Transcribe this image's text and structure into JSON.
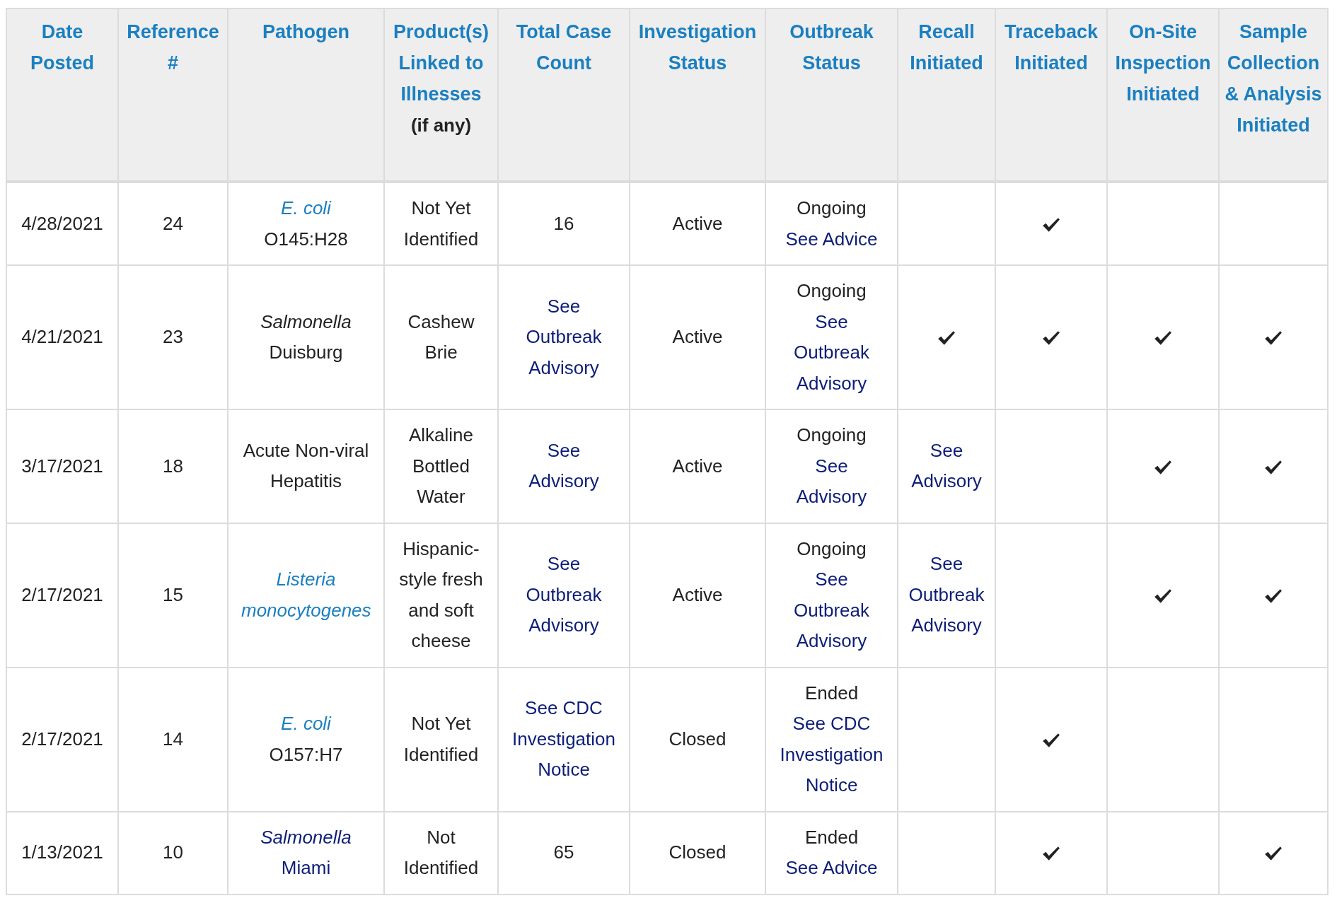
{
  "table": {
    "columns": [
      {
        "label": "Date Posted"
      },
      {
        "label": "Reference #"
      },
      {
        "label": "Pathogen"
      },
      {
        "label": "Product(s) Linked to Illnesses",
        "note": "(if any)"
      },
      {
        "label": "Total Case Count"
      },
      {
        "label": "Investigation Status"
      },
      {
        "label": "Outbreak Status"
      },
      {
        "label": "Recall Initiated"
      },
      {
        "label": "Traceback Initiated"
      },
      {
        "label": "On-Site Inspection Initiated"
      },
      {
        "label": "Sample Collection & Analysis Initiated"
      }
    ],
    "rows": [
      {
        "cells": [
          {
            "kind": "text",
            "parts": [
              {
                "text": "4/28/2021",
                "kind": "plain"
              }
            ]
          },
          {
            "kind": "text",
            "parts": [
              {
                "text": "24",
                "kind": "plain"
              }
            ]
          },
          {
            "kind": "text",
            "parts": [
              {
                "text": "E. coli",
                "kind": "species"
              },
              {
                "text": "O145:H28",
                "kind": "plain"
              }
            ]
          },
          {
            "kind": "text",
            "parts": [
              {
                "text": "Not Yet Identified",
                "kind": "plain"
              }
            ]
          },
          {
            "kind": "text",
            "parts": [
              {
                "text": "16",
                "kind": "plain"
              }
            ]
          },
          {
            "kind": "text",
            "parts": [
              {
                "text": "Active",
                "kind": "plain"
              }
            ]
          },
          {
            "kind": "text",
            "parts": [
              {
                "text": "Ongoing",
                "kind": "plain"
              },
              {
                "text": "See Advice",
                "kind": "link"
              }
            ]
          },
          {
            "kind": "check",
            "checked": false
          },
          {
            "kind": "check",
            "checked": true
          },
          {
            "kind": "check",
            "checked": false
          },
          {
            "kind": "check",
            "checked": false
          }
        ]
      },
      {
        "cells": [
          {
            "kind": "text",
            "parts": [
              {
                "text": "4/21/2021",
                "kind": "plain"
              }
            ]
          },
          {
            "kind": "text",
            "parts": [
              {
                "text": "23",
                "kind": "plain"
              }
            ]
          },
          {
            "kind": "text",
            "parts": [
              {
                "text": "Salmonella",
                "kind": "italic"
              },
              {
                "text": "Duisburg",
                "kind": "plain"
              }
            ]
          },
          {
            "kind": "text",
            "parts": [
              {
                "text": "Cashew Brie",
                "kind": "plain"
              }
            ]
          },
          {
            "kind": "text",
            "parts": [
              {
                "text": "See Outbreak Advisory",
                "kind": "link"
              }
            ]
          },
          {
            "kind": "text",
            "parts": [
              {
                "text": "Active",
                "kind": "plain"
              }
            ]
          },
          {
            "kind": "text",
            "parts": [
              {
                "text": "Ongoing",
                "kind": "plain"
              },
              {
                "text": "See Outbreak Advisory",
                "kind": "link"
              }
            ]
          },
          {
            "kind": "check",
            "checked": true
          },
          {
            "kind": "check",
            "checked": true
          },
          {
            "kind": "check",
            "checked": true
          },
          {
            "kind": "check",
            "checked": true
          }
        ]
      },
      {
        "cells": [
          {
            "kind": "text",
            "parts": [
              {
                "text": "3/17/2021",
                "kind": "plain"
              }
            ]
          },
          {
            "kind": "text",
            "parts": [
              {
                "text": "18",
                "kind": "plain"
              }
            ]
          },
          {
            "kind": "text",
            "parts": [
              {
                "text": "Acute Non-viral Hepatitis",
                "kind": "plain"
              }
            ]
          },
          {
            "kind": "text",
            "parts": [
              {
                "text": "Alkaline Bottled Water",
                "kind": "plain"
              }
            ]
          },
          {
            "kind": "text",
            "parts": [
              {
                "text": "See Advisory",
                "kind": "link"
              }
            ]
          },
          {
            "kind": "text",
            "parts": [
              {
                "text": "Active",
                "kind": "plain"
              }
            ]
          },
          {
            "kind": "text",
            "parts": [
              {
                "text": "Ongoing",
                "kind": "plain"
              },
              {
                "text": "See Advisory",
                "kind": "link"
              }
            ]
          },
          {
            "kind": "text",
            "parts": [
              {
                "text": "See Advisory",
                "kind": "link"
              }
            ]
          },
          {
            "kind": "check",
            "checked": false
          },
          {
            "kind": "check",
            "checked": true
          },
          {
            "kind": "check",
            "checked": true
          }
        ]
      },
      {
        "cells": [
          {
            "kind": "text",
            "parts": [
              {
                "text": "2/17/2021",
                "kind": "plain"
              }
            ]
          },
          {
            "kind": "text",
            "parts": [
              {
                "text": "15",
                "kind": "plain"
              }
            ]
          },
          {
            "kind": "text",
            "parts": [
              {
                "text": "Listeria monocytogenes",
                "kind": "species"
              }
            ]
          },
          {
            "kind": "text",
            "parts": [
              {
                "text": "Hispanic-style fresh and soft cheese",
                "kind": "plain"
              }
            ]
          },
          {
            "kind": "text",
            "parts": [
              {
                "text": "See Outbreak Advisory",
                "kind": "link"
              }
            ]
          },
          {
            "kind": "text",
            "parts": [
              {
                "text": "Active",
                "kind": "plain"
              }
            ]
          },
          {
            "kind": "text",
            "parts": [
              {
                "text": "Ongoing",
                "kind": "plain"
              },
              {
                "text": "See Outbreak Advisory",
                "kind": "link"
              }
            ]
          },
          {
            "kind": "text",
            "parts": [
              {
                "text": "See Outbreak Advisory",
                "kind": "link"
              }
            ]
          },
          {
            "kind": "check",
            "checked": false
          },
          {
            "kind": "check",
            "checked": true
          },
          {
            "kind": "check",
            "checked": true
          }
        ]
      },
      {
        "cells": [
          {
            "kind": "text",
            "parts": [
              {
                "text": "2/17/2021",
                "kind": "plain"
              }
            ]
          },
          {
            "kind": "text",
            "parts": [
              {
                "text": "14",
                "kind": "plain"
              }
            ]
          },
          {
            "kind": "text",
            "parts": [
              {
                "text": "E. coli",
                "kind": "species"
              },
              {
                "text": "O157:H7",
                "kind": "plain"
              }
            ]
          },
          {
            "kind": "text",
            "parts": [
              {
                "text": "Not Yet Identified",
                "kind": "plain"
              }
            ]
          },
          {
            "kind": "text",
            "parts": [
              {
                "text": "See CDC Investigation Notice",
                "kind": "link"
              }
            ]
          },
          {
            "kind": "text",
            "parts": [
              {
                "text": "Closed",
                "kind": "plain"
              }
            ]
          },
          {
            "kind": "text",
            "parts": [
              {
                "text": "Ended",
                "kind": "plain"
              },
              {
                "text": "See CDC Investigation Notice",
                "kind": "link"
              }
            ]
          },
          {
            "kind": "check",
            "checked": false
          },
          {
            "kind": "check",
            "checked": true
          },
          {
            "kind": "check",
            "checked": false
          },
          {
            "kind": "check",
            "checked": false
          }
        ]
      },
      {
        "cells": [
          {
            "kind": "text",
            "parts": [
              {
                "text": "1/13/2021",
                "kind": "plain"
              }
            ]
          },
          {
            "kind": "text",
            "parts": [
              {
                "text": "10",
                "kind": "plain"
              }
            ]
          },
          {
            "kind": "text",
            "parts": [
              {
                "text": "Salmonella",
                "kind": "link-italic"
              },
              {
                "text": "Miami",
                "kind": "link"
              }
            ]
          },
          {
            "kind": "text",
            "parts": [
              {
                "text": "Not Identified",
                "kind": "plain"
              }
            ]
          },
          {
            "kind": "text",
            "parts": [
              {
                "text": "65",
                "kind": "plain"
              }
            ]
          },
          {
            "kind": "text",
            "parts": [
              {
                "text": "Closed",
                "kind": "plain"
              }
            ]
          },
          {
            "kind": "text",
            "parts": [
              {
                "text": "Ended",
                "kind": "plain"
              },
              {
                "text": "See Advice",
                "kind": "link"
              }
            ]
          },
          {
            "kind": "check",
            "checked": false
          },
          {
            "kind": "check",
            "checked": true
          },
          {
            "kind": "check",
            "checked": false
          },
          {
            "kind": "check",
            "checked": true
          }
        ]
      }
    ]
  }
}
